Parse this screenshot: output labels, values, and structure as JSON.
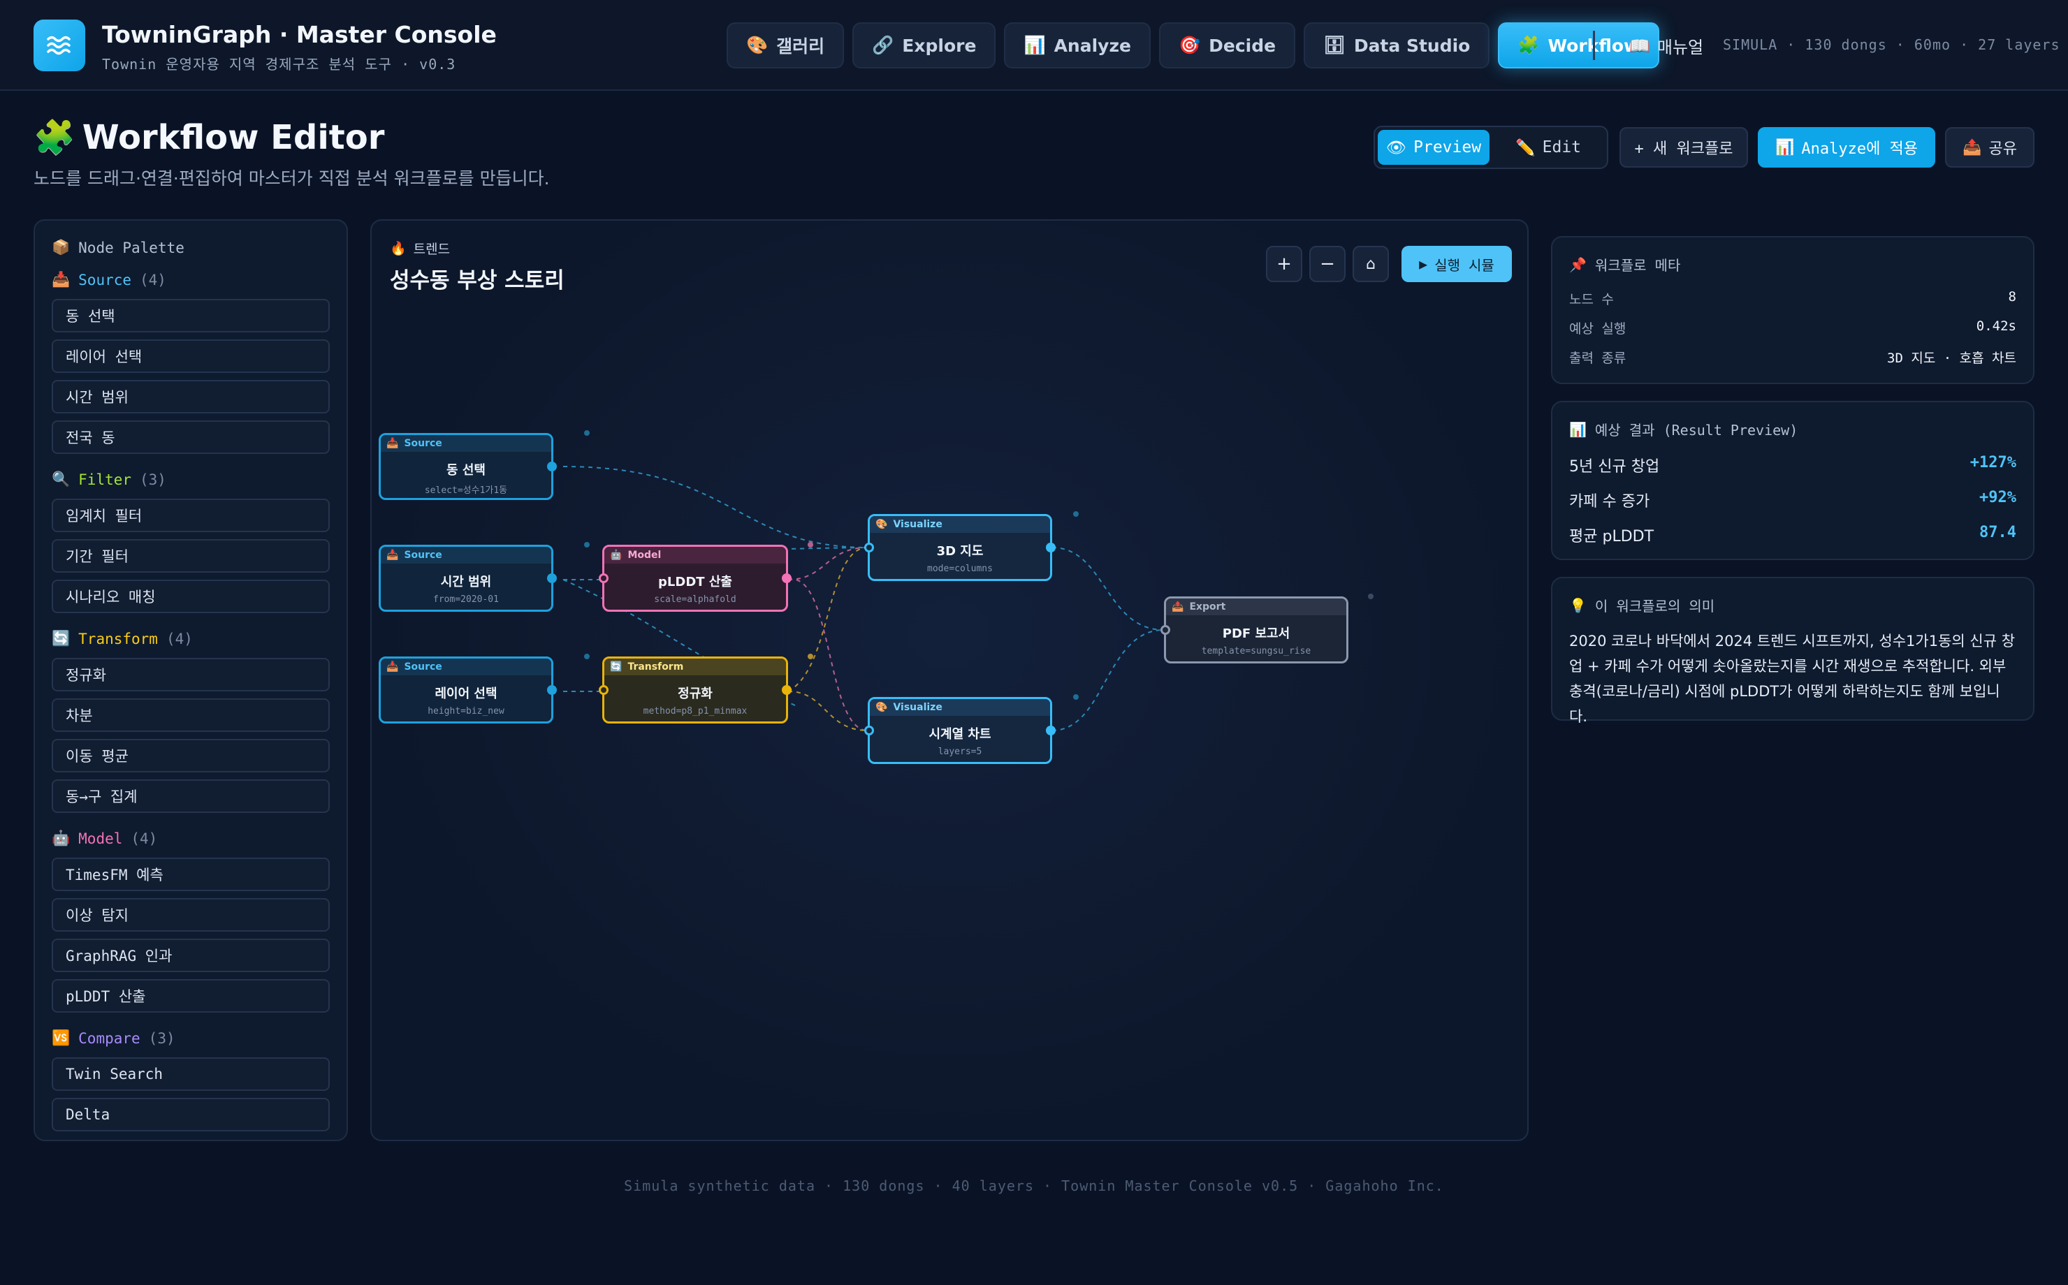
{
  "header": {
    "title": "TowninGraph · Master Console",
    "subtitle": "Townin 운영자용 지역 경제구조 분석 도구 · v0.3",
    "nav": [
      {
        "icon": "🎨",
        "label": "갤러리"
      },
      {
        "icon": "🔗",
        "label": "Explore"
      },
      {
        "icon": "📊",
        "label": "Analyze"
      },
      {
        "icon": "🎯",
        "label": "Decide"
      },
      {
        "icon": "🗄",
        "label": "Data Studio"
      },
      {
        "icon": "🧩",
        "label": "Workflow"
      }
    ],
    "active_nav": "Workflow",
    "manual_label": "매뉴얼",
    "manual_icon": "📖",
    "stats": "SIMULA · 130 dongs · 60mo · 27 layers"
  },
  "page": {
    "title_icon": "🧩",
    "title": "Workflow Editor",
    "description": "노드를 드래그·연결·편집하여 마스터가 직접 분석 워크플로를 만듭니다.",
    "mode_preview": "Preview",
    "mode_preview_icon": "👁",
    "mode_edit": "Edit",
    "mode_edit_icon": "✏️",
    "new_workflow": "+ 새 워크플로",
    "apply_analyze": "Analyze에 적용",
    "apply_icon": "📊",
    "share": "공유",
    "share_icon": "📤"
  },
  "palette": {
    "title": "Node Palette",
    "title_icon": "📦",
    "groups": [
      {
        "icon": "📥",
        "name": "Source",
        "count": "(4)",
        "color": "#4fc3f7",
        "items": [
          "동 선택",
          "레이어 선택",
          "시간 범위",
          "전국 동"
        ]
      },
      {
        "icon": "🔍",
        "name": "Filter",
        "count": "(3)",
        "color": "#a3e635",
        "items": [
          "임계치 필터",
          "기간 필터",
          "시나리오 매칭"
        ]
      },
      {
        "icon": "🔄",
        "name": "Transform",
        "count": "(4)",
        "color": "#facc15",
        "items": [
          "정규화",
          "차분",
          "이동 평균",
          "동→구 집계"
        ]
      },
      {
        "icon": "🤖",
        "name": "Model",
        "count": "(4)",
        "color": "#f472b6",
        "items": [
          "TimesFM 예측",
          "이상 탐지",
          "GraphRAG 인과",
          "pLDDT 산출"
        ]
      },
      {
        "icon": "🆚",
        "name": "Compare",
        "count": "(3)",
        "color": "#a78bfa",
        "items": [
          "Twin Search",
          "Delta"
        ]
      }
    ]
  },
  "canvas": {
    "tag_icon": "🔥",
    "tag": "트렌드",
    "title": "성수동 부상 스토리",
    "run_label": "실행 시뮬",
    "nodes": [
      {
        "id": "n1",
        "kind": "src",
        "type_icon": "📥",
        "type": "Source",
        "title": "동 선택",
        "param": "select=성수1가1동"
      },
      {
        "id": "n2",
        "kind": "src",
        "type_icon": "📥",
        "type": "Source",
        "title": "시간 범위",
        "param": "from=2020-01"
      },
      {
        "id": "n3",
        "kind": "src",
        "type_icon": "📥",
        "type": "Source",
        "title": "레이어 선택",
        "param": "height=biz_new"
      },
      {
        "id": "n4",
        "kind": "mod",
        "type_icon": "🤖",
        "type": "Model",
        "title": "pLDDT 산출",
        "param": "scale=alphafold"
      },
      {
        "id": "n5",
        "kind": "tr",
        "type_icon": "🔄",
        "type": "Transform",
        "title": "정규화",
        "param": "method=p8_p1_minmax"
      },
      {
        "id": "n6",
        "kind": "vis",
        "type_icon": "🎨",
        "type": "Visualize",
        "title": "3D 지도",
        "param": "mode=columns"
      },
      {
        "id": "n7",
        "kind": "vis",
        "type_icon": "🎨",
        "type": "Visualize",
        "title": "시계열 차트",
        "param": "layers=5"
      },
      {
        "id": "n8",
        "kind": "exp",
        "type_icon": "📤",
        "type": "Export",
        "title": "PDF 보고서",
        "param": "template=sungsu_rise"
      }
    ]
  },
  "meta": {
    "title_icon": "📌",
    "title": "워크플로 메타",
    "rows": [
      {
        "k": "노드 수",
        "v": "8"
      },
      {
        "k": "예상 실행",
        "v": "0.42s"
      },
      {
        "k": "출력 종류",
        "v": "3D 지도 · 호흡 차트"
      }
    ]
  },
  "preview": {
    "title_icon": "📊",
    "title": "예상 결과 (Result Preview)",
    "rows": [
      {
        "k": "5년 신규 창업",
        "v": "+127%"
      },
      {
        "k": "카페 수 증가",
        "v": "+92%"
      },
      {
        "k": "평균 pLDDT",
        "v": "87.4"
      }
    ]
  },
  "meaning": {
    "title_icon": "💡",
    "title": "이 워크플로의 의미",
    "text": "2020 코로나 바닥에서 2024 트렌드 시프트까지, 성수1가1동의 신규 창업 + 카페 수가 어떻게 솟아올랐는지를 시간 재생으로 추적합니다. 외부 충격(코로나/금리) 시점에 pLDDT가 어떻게 하락하는지도 함께 보입니다."
  },
  "footer": "Simula synthetic data · 130 dongs · 40 layers · Townin Master Console v0.5 · Gagahoho Inc."
}
